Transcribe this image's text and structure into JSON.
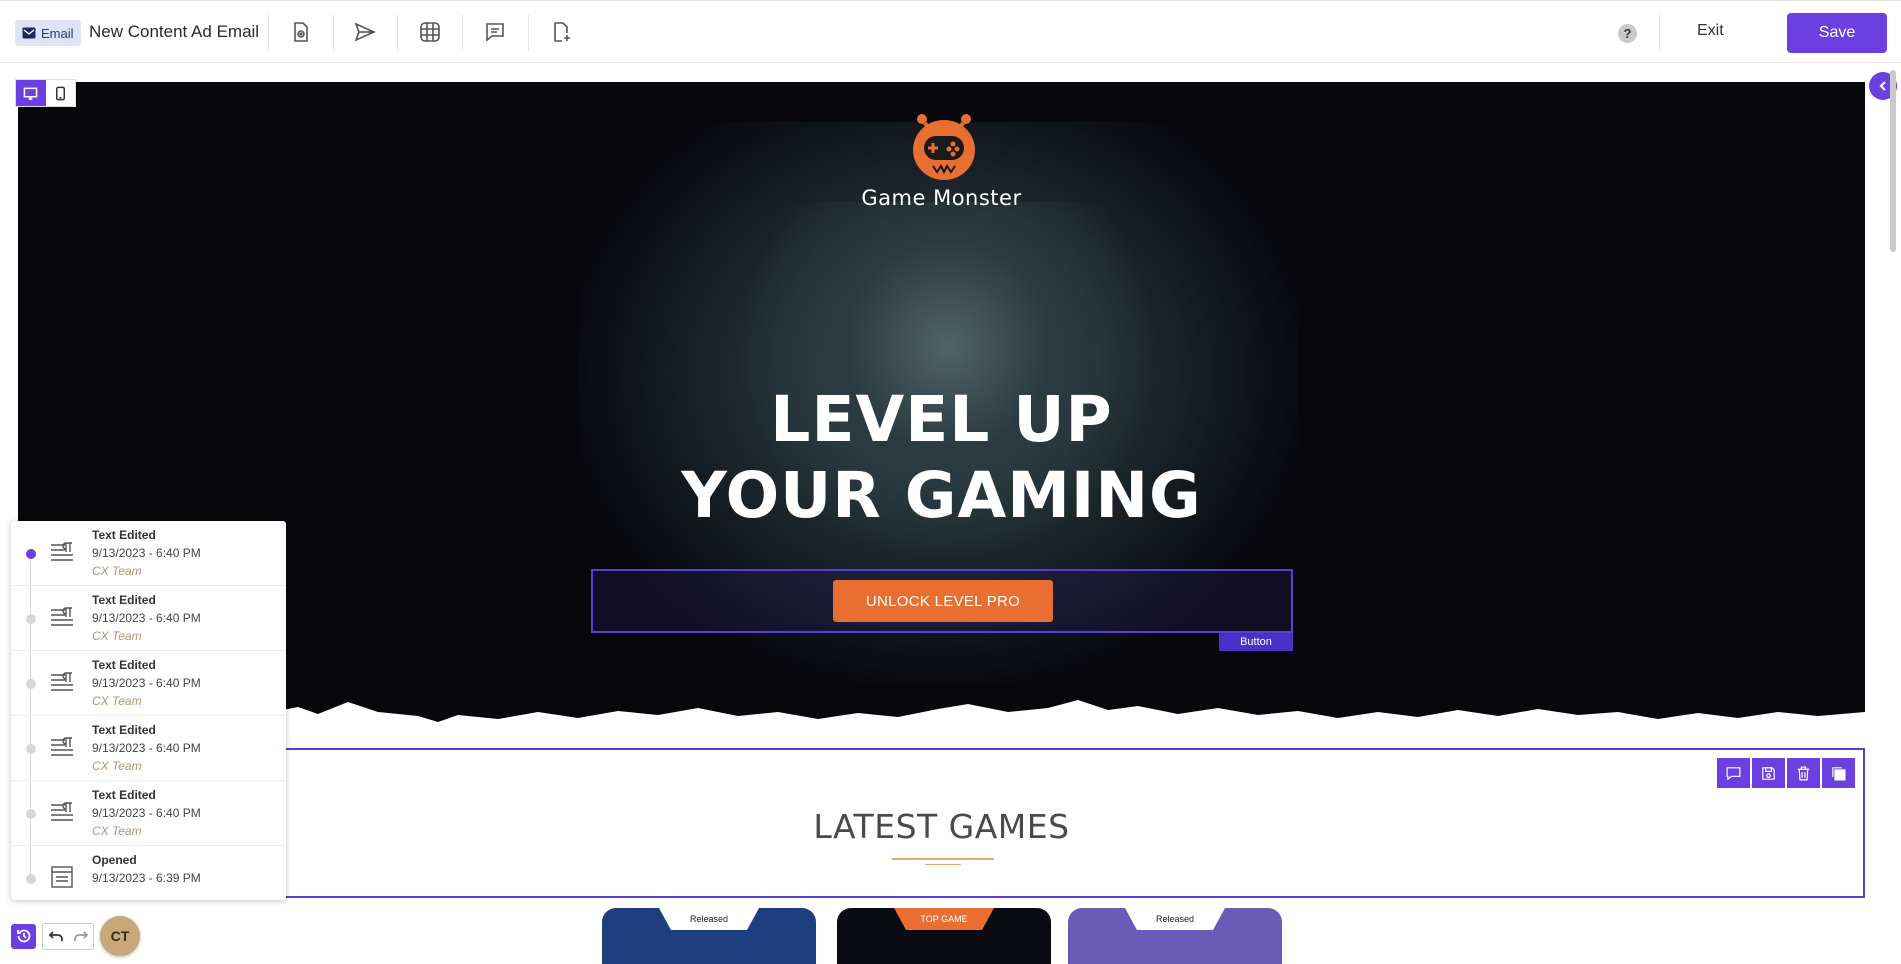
{
  "topbar": {
    "type_badge": "Email",
    "doc_title": "New Content Ad Email",
    "tools": [
      {
        "icon": "preview-file-icon"
      },
      {
        "icon": "send-icon"
      },
      {
        "icon": "grid-icon"
      },
      {
        "icon": "comment-icon"
      },
      {
        "icon": "add-page-icon"
      }
    ],
    "help_label": "?",
    "exit_label": "Exit",
    "save_label": "Save"
  },
  "device_toggle": {
    "active": "desktop"
  },
  "hero": {
    "brand": "Game Monster",
    "headline_line1": "LEVEL UP",
    "headline_line2": "YOUR GAMING",
    "cta_label": "UNLOCK LEVEL PRO",
    "selected_block_tag": "Button"
  },
  "games": {
    "title": "LATEST GAMES",
    "cards": [
      {
        "tag": "Released"
      },
      {
        "tag": "TOP GAME"
      },
      {
        "tag": "Released"
      }
    ]
  },
  "history": {
    "items": [
      {
        "action": "Text Edited",
        "time": "9/13/2023 - 6:40 PM",
        "user": "CX Team",
        "active": true
      },
      {
        "action": "Text Edited",
        "time": "9/13/2023 - 6:40 PM",
        "user": "CX Team",
        "active": false
      },
      {
        "action": "Text Edited",
        "time": "9/13/2023 - 6:40 PM",
        "user": "CX Team",
        "active": false
      },
      {
        "action": "Text Edited",
        "time": "9/13/2023 - 6:40 PM",
        "user": "CX Team",
        "active": false
      },
      {
        "action": "Text Edited",
        "time": "9/13/2023 - 6:40 PM",
        "user": "CX Team",
        "active": false
      },
      {
        "action": "Opened",
        "time": "9/13/2023 - 6:39 PM",
        "user": "",
        "active": false
      }
    ]
  },
  "user": {
    "initials": "CT"
  },
  "colors": {
    "accent": "#6b3fe0",
    "cta": "#e86f31",
    "hero_bg": "#07070c",
    "user_text": "#b9956a"
  }
}
